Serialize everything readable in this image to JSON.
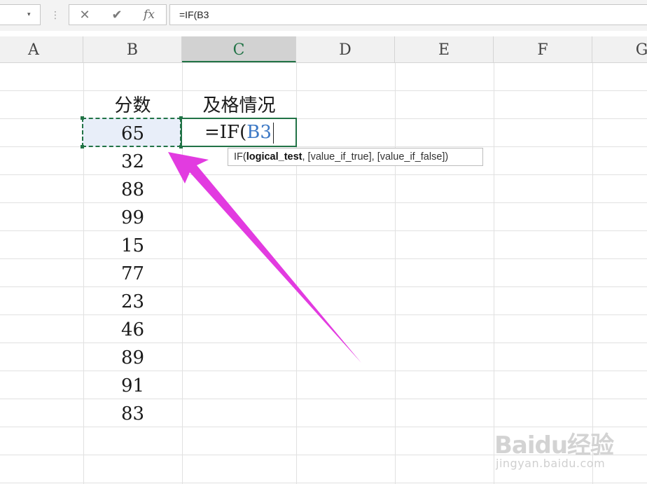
{
  "formula_bar": {
    "name_box_value": "",
    "name_box_arrow": "▾",
    "separator": "⋮",
    "cancel_icon": "✕",
    "enter_icon": "✔",
    "fx_label": "fx",
    "formula": "=IF(B3"
  },
  "columns": [
    "A",
    "B",
    "C",
    "D",
    "E",
    "F",
    "G"
  ],
  "active_column": "C",
  "cells": {
    "B2": "分数",
    "C2": "及格情况",
    "B3": "65",
    "B4": "32",
    "B5": "88",
    "B6": "99",
    "B7": "15",
    "B8": "77",
    "B9": "23",
    "B10": "46",
    "B11": "89",
    "B12": "91",
    "B13": "83"
  },
  "edit": {
    "prefix": "=IF(",
    "reference": "B3"
  },
  "tooltip": {
    "fn": "IF(",
    "arg_active": "logical_test",
    "rest": ", [value_if_true], [value_if_false])"
  },
  "watermark": {
    "logo": "Baidu经验",
    "url": "jingyan.baidu.com"
  },
  "colors": {
    "selection": "#217346",
    "arrow": "#e23be0",
    "reference": "#3c78c5"
  }
}
